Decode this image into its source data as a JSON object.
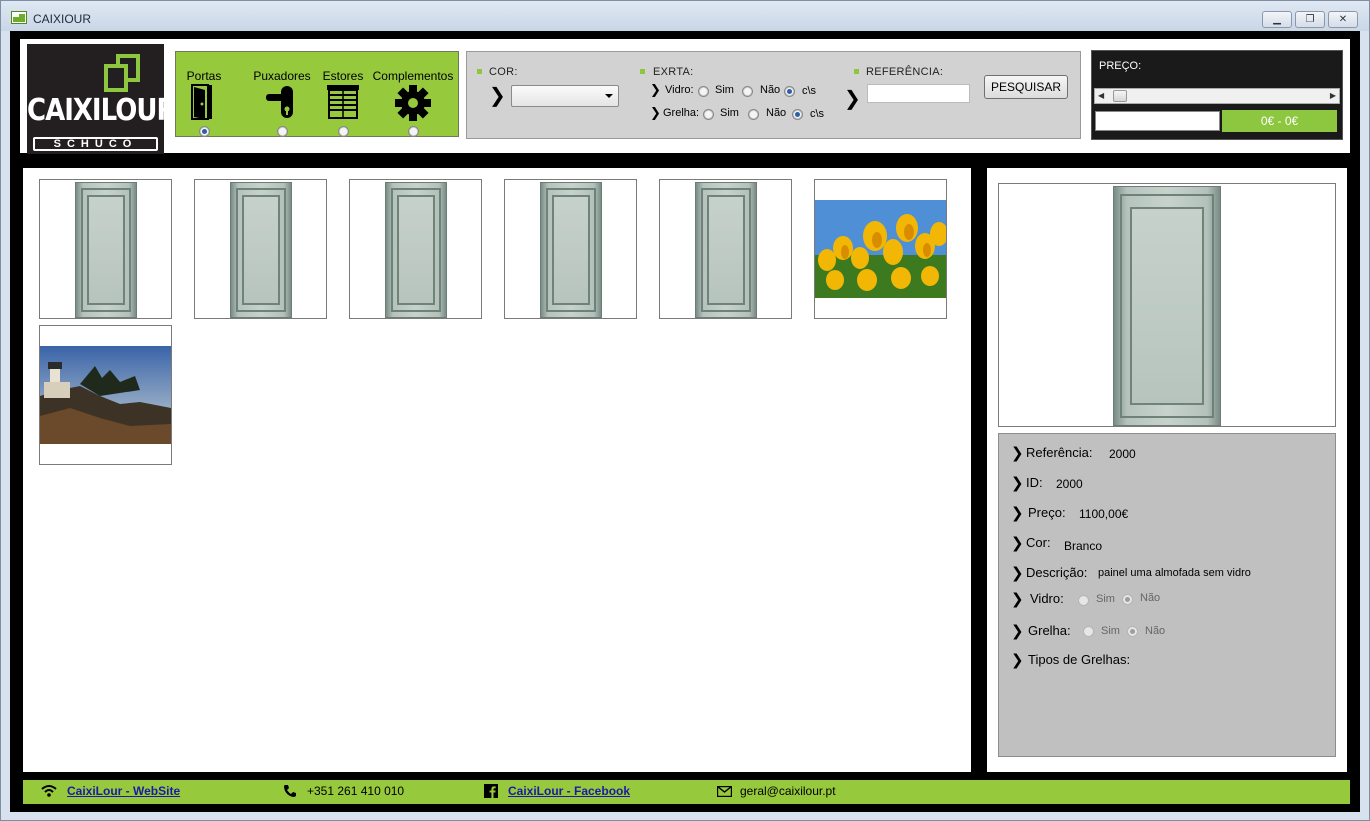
{
  "window": {
    "title": "CAIXIOUR",
    "minimize_symbol": "▁",
    "maximize_symbol": "❐",
    "close_symbol": "✕"
  },
  "logo": {
    "brand": "CAIXILOUR",
    "sub": "SCHÜCO"
  },
  "categories": [
    {
      "label": "Portas",
      "icon": "door-icon",
      "selected": true
    },
    {
      "label": "Puxadores",
      "icon": "handle-icon",
      "selected": false
    },
    {
      "label": "Estores",
      "icon": "shutter-icon",
      "selected": false
    },
    {
      "label": "Complementos",
      "icon": "gear-icon",
      "selected": false
    }
  ],
  "filters": {
    "cor_label": "COR:",
    "cor_value": "",
    "extra_label": "EXRTA:",
    "vidro_label": "Vidro:",
    "grelha_label": "Grelha:",
    "opt_sim": "Sim",
    "opt_nao": "Não",
    "opt_cs": "c\\s",
    "vidro_selected": "c\\s",
    "grelha_selected": "c\\s",
    "referencia_label": "REFERÊNCIA:",
    "referencia_value": "",
    "search_button": "PESQUISAR"
  },
  "price": {
    "label": "PREÇO:",
    "value": "",
    "range": "0€ - 0€"
  },
  "gallery": {
    "items": [
      {
        "kind": "door"
      },
      {
        "kind": "door"
      },
      {
        "kind": "door"
      },
      {
        "kind": "door"
      },
      {
        "kind": "door"
      },
      {
        "kind": "tulips"
      },
      {
        "kind": "lighthouse"
      }
    ]
  },
  "detail": {
    "referencia_label": "Referência:",
    "referencia_value": "2000",
    "id_label": "ID:",
    "id_value": "2000",
    "preco_label": "Preço:",
    "preco_value": "1100,00€",
    "cor_label": "Cor:",
    "cor_value": "Branco",
    "descricao_label": "Descrição:",
    "descricao_value": "painel uma almofada sem vidro",
    "vidro_label": "Vidro:",
    "grelha_label": "Grelha:",
    "opt_sim": "Sim",
    "opt_nao": "Não",
    "vidro_selected": "Não",
    "grelha_selected": "Não",
    "tipos_label": "Tipos de Grelhas:"
  },
  "footer": {
    "website": "CaixiLour - WebSite",
    "phone": "+351 261 410 010",
    "facebook": "CaixiLour - Facebook",
    "email": "geral@caixilour.pt"
  },
  "colors": {
    "accent_green": "#97c93d",
    "link_blue": "#1a1aa6"
  }
}
